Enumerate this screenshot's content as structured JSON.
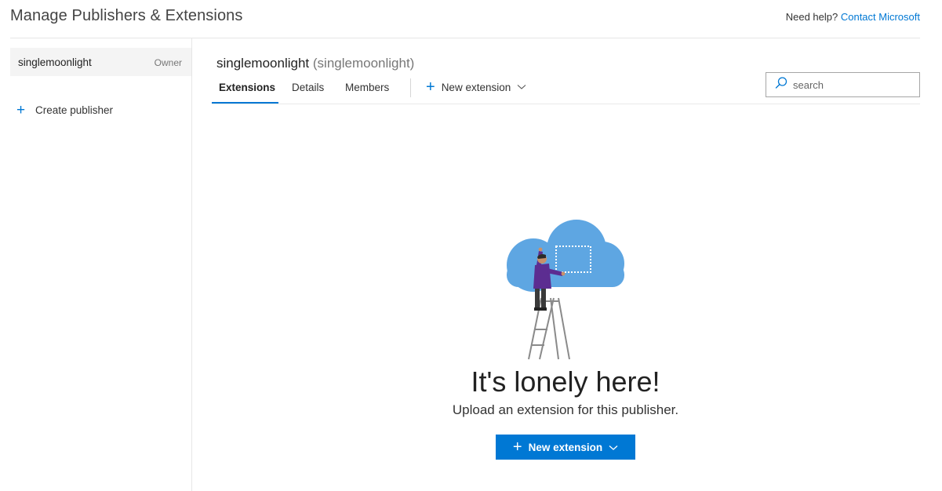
{
  "header": {
    "title": "Manage Publishers & Extensions",
    "help_text": "Need help?",
    "help_link": "Contact Microsoft"
  },
  "sidebar": {
    "publisher": {
      "name": "singlemoonlight",
      "role": "Owner"
    },
    "create_label": "Create publisher"
  },
  "publisher": {
    "name": "singlemoonlight",
    "id": "(singlemoonlight)"
  },
  "tabs": [
    {
      "label": "Extensions",
      "active": true
    },
    {
      "label": "Details",
      "active": false
    },
    {
      "label": "Members",
      "active": false
    }
  ],
  "new_extension_label": "New extension",
  "search": {
    "placeholder": "search",
    "value": ""
  },
  "empty_state": {
    "title": "It's lonely here!",
    "subtitle": "Upload an extension for this publisher.",
    "button_label": "New extension"
  },
  "colors": {
    "accent": "#0078d4",
    "cloud": "#5ea6e2",
    "figure_shirt": "#5c2d91"
  },
  "icons": {
    "plus": "plus-icon",
    "chevron": "chevron-down-icon",
    "search": "search-icon"
  }
}
